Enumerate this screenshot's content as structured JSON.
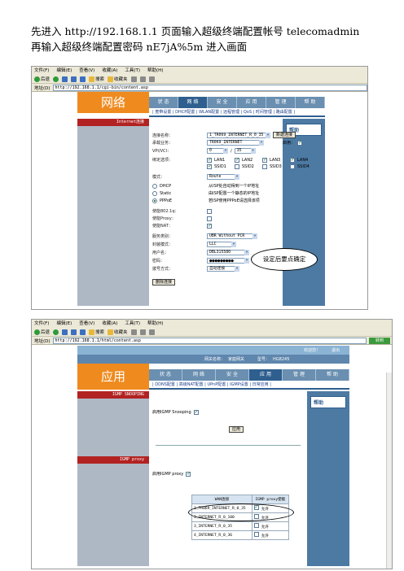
{
  "intro": {
    "line1": "先进入 http://192.168.1.1 页面输入超级终端配置帐号  telecomadmin",
    "line2": "再输入超级终端配置密码  nE7jA%5m  进入画面"
  },
  "browser": {
    "menu": [
      "文件(F)",
      "编辑(E)",
      "查看(V)",
      "收藏(A)",
      "工具(T)",
      "帮助(H)"
    ],
    "back": "后退",
    "search": "搜索",
    "favorites": "收藏夹",
    "address_label": "地址(D)",
    "go": "转到"
  },
  "shot1": {
    "address": "http://192.168.1.1/cgi-bin/content.asp",
    "logo": "网络",
    "nav": [
      "状 态",
      "网 络",
      "安 全",
      "应 用",
      "管 理",
      "帮 助"
    ],
    "subnav": "| 宽带设置 | DHCP配置 | WLAN配置 | 远程管理 | QoS | 时间管理 | 路由配置 |",
    "section": "Internet连接",
    "help": "帮助",
    "fields": {
      "conn_name_label": "连接名称：",
      "conn_name": "1_TR069_INTERNET_R_0_35",
      "new_conn": "新建连接",
      "service_label": "承载业务：",
      "service": "TR069_INTERNET",
      "enable_label": "启用：",
      "vpi_label": "VPI/VCI：",
      "vpi": "0",
      "vci": "35",
      "bind_label": "绑定选项：",
      "lan1": "LAN1",
      "lan2": "LAN2",
      "lan3": "LAN3",
      "lan4": "LAN4",
      "ssid1": "SSID1",
      "ssid2": "SSID2",
      "ssid3": "SSID3",
      "ssid4": "SSID4",
      "mode_label": "模式：",
      "mode": "Route",
      "dhcp": "DHCP",
      "dhcp_desc": "从ISP处自动得到一个IP地址",
      "static": "Static",
      "static_desc": "由ISP配置一个静态的IP地址",
      "pppoe": "PPPoE",
      "pppoe_desc": "若ISP使用PPPoE请选择该项",
      "enable_8021q": "使能802.1q：",
      "enable_proxy": "使能Proxy：",
      "enable_nat": "使能NAT：",
      "service_type_label": "服务类别：",
      "service_type": "UBR Without PCR",
      "encap_label": "封装模式：",
      "encap": "LLC",
      "user_label": "用户名：",
      "user": "DBL315580",
      "pass_label": "密码：",
      "pass": "●●●●●●●●●",
      "dial_label": "拨号方式：",
      "dial": "自动连接",
      "delete_btn": "删除连接"
    },
    "callout": "设定后要点确定"
  },
  "shot2": {
    "address": "http://192.168.1.1/html/content.asp",
    "topband_welcome": "欢迎您！",
    "topband_exit": "退出",
    "device_label": "网关名称：",
    "device_name": "家庭网关",
    "model_label": "型号：",
    "model": "HG8245",
    "logo": "应用",
    "nav": [
      "状 态",
      "网 络",
      "安 全",
      "应 用",
      "管 理",
      "帮 助"
    ],
    "subnav": "| DDNS配置 | 高级NAT配置 | UPnP配置 | IGMP设置 | 日常应用 |",
    "section1": "IGMP SNOOPING",
    "section2": "IGMP proxy",
    "help": "帮助",
    "snooping_label": "启用IGMP Snooping",
    "apply": "应用",
    "proxy_label": "启用IGMP proxy",
    "table_headers": [
      "WAN连接",
      "IGMP proxy使能"
    ],
    "table_rows": [
      {
        "name": "1_TR069_INTERNET_R_0_35",
        "val": "允许",
        "on": true
      },
      {
        "name": "2_INTERNET_R_0_100",
        "val": "允许",
        "on": false
      },
      {
        "name": "3_INTERNET_R_0_35",
        "val": "允许",
        "on": false
      },
      {
        "name": "4_INTERNET_R_0_36",
        "val": "允许",
        "on": false
      }
    ]
  }
}
